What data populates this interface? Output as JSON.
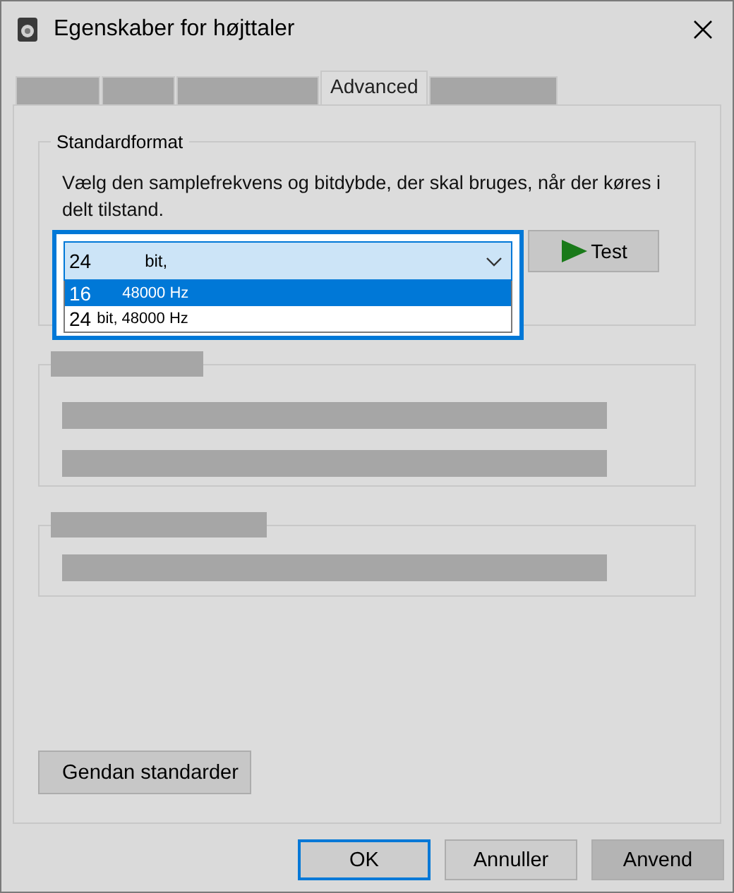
{
  "window": {
    "title": "Egenskaber for højttaler"
  },
  "tabs": [
    {
      "selected": false
    },
    {
      "selected": false
    },
    {
      "selected": false
    },
    {
      "label": "Advanced",
      "selected": true
    },
    {
      "selected": false
    }
  ],
  "standard_format": {
    "legend": "Standardformat",
    "description": "Vælg den samplefrekvens og bitdybde, der skal bruges, når der køres i delt tilstand.",
    "dropdown": {
      "value_number": "24",
      "value_unit": "bit,",
      "expanded": true,
      "options": [
        {
          "number": "16",
          "text": "48000 Hz",
          "selected": true
        },
        {
          "number": "24",
          "text": "bit, 48000 Hz",
          "selected": false
        }
      ]
    },
    "test_button": "Test"
  },
  "restore_button": "Gendan standarder",
  "buttons": [
    {
      "label": "OK",
      "kind": "focused"
    },
    {
      "label": "Annuller",
      "kind": "normal"
    },
    {
      "label": "Anvend",
      "kind": "shaded"
    }
  ]
}
